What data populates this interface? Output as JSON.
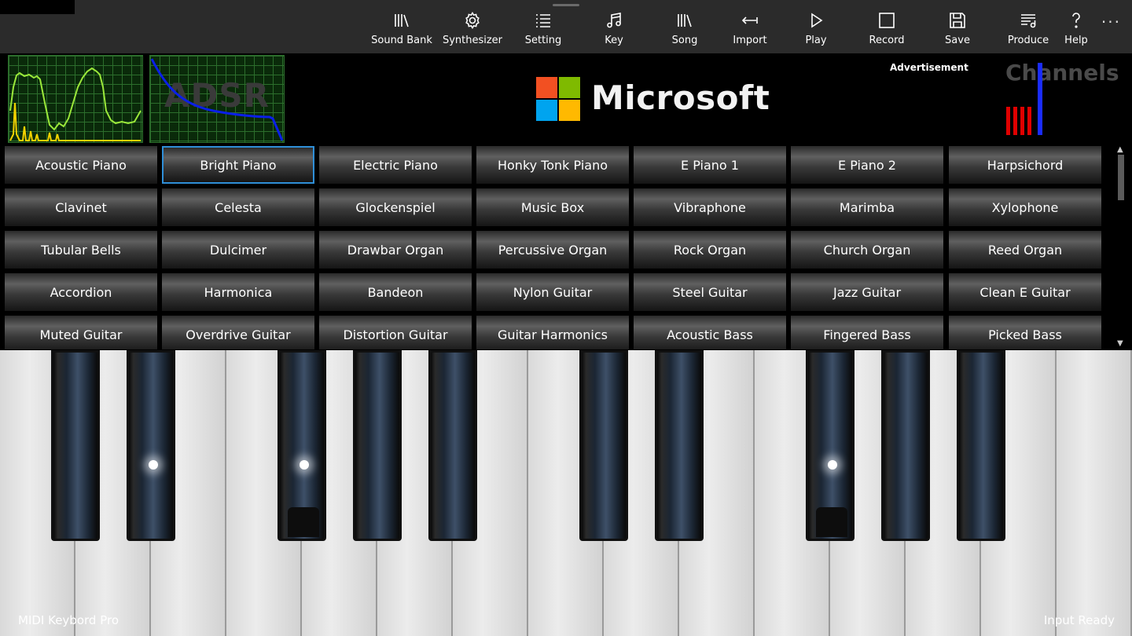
{
  "toolbar": {
    "items": [
      {
        "label": "Sound Bank",
        "icon": "library-icon"
      },
      {
        "label": "Synthesizer",
        "icon": "gear-icon"
      },
      {
        "label": "Setting",
        "icon": "list-icon"
      },
      {
        "label": "Key",
        "icon": "music-note-icon"
      },
      {
        "label": "Song",
        "icon": "library-icon"
      },
      {
        "label": "Import",
        "icon": "import-arrow-icon"
      },
      {
        "label": "Play",
        "icon": "play-icon"
      },
      {
        "label": "Record",
        "icon": "stop-square-icon"
      },
      {
        "label": "Save",
        "icon": "save-icon"
      },
      {
        "label": "Produce",
        "icon": "playlist-icon"
      },
      {
        "label": "Help",
        "icon": "question-icon"
      }
    ],
    "more": "···"
  },
  "header": {
    "adsr_label": "ADSR",
    "brand_text": "Microsoft",
    "ad_label": "Advertisement",
    "channels_title": "Channels",
    "colors": {
      "ms_red": "#f25022",
      "ms_green": "#7fba00",
      "ms_blue": "#00a4ef",
      "ms_yellow": "#ffb900"
    }
  },
  "instruments": {
    "selected": "Bright Piano",
    "items": [
      "Acoustic Piano",
      "Bright Piano",
      "Electric Piano",
      "Honky Tonk Piano",
      "E Piano 1",
      "E Piano 2",
      "Harpsichord",
      "Clavinet",
      "Celesta",
      "Glockenspiel",
      "Music Box",
      "Vibraphone",
      "Marimba",
      "Xylophone",
      "Tubular Bells",
      "Dulcimer",
      "Drawbar Organ",
      "Percussive Organ",
      "Rock Organ",
      "Church Organ",
      "Reed Organ",
      "Accordion",
      "Harmonica",
      "Bandeon",
      "Nylon Guitar",
      "Steel Guitar",
      "Jazz Guitar",
      "Clean E Guitar",
      "Muted Guitar",
      "Overdrive Guitar",
      "Distortion Guitar",
      "Guitar Harmonics",
      "Acoustic Bass",
      "Fingered Bass",
      "Picked Bass"
    ]
  },
  "status": {
    "app_name": "MIDI Keybord Pro",
    "state": "Input Ready"
  }
}
